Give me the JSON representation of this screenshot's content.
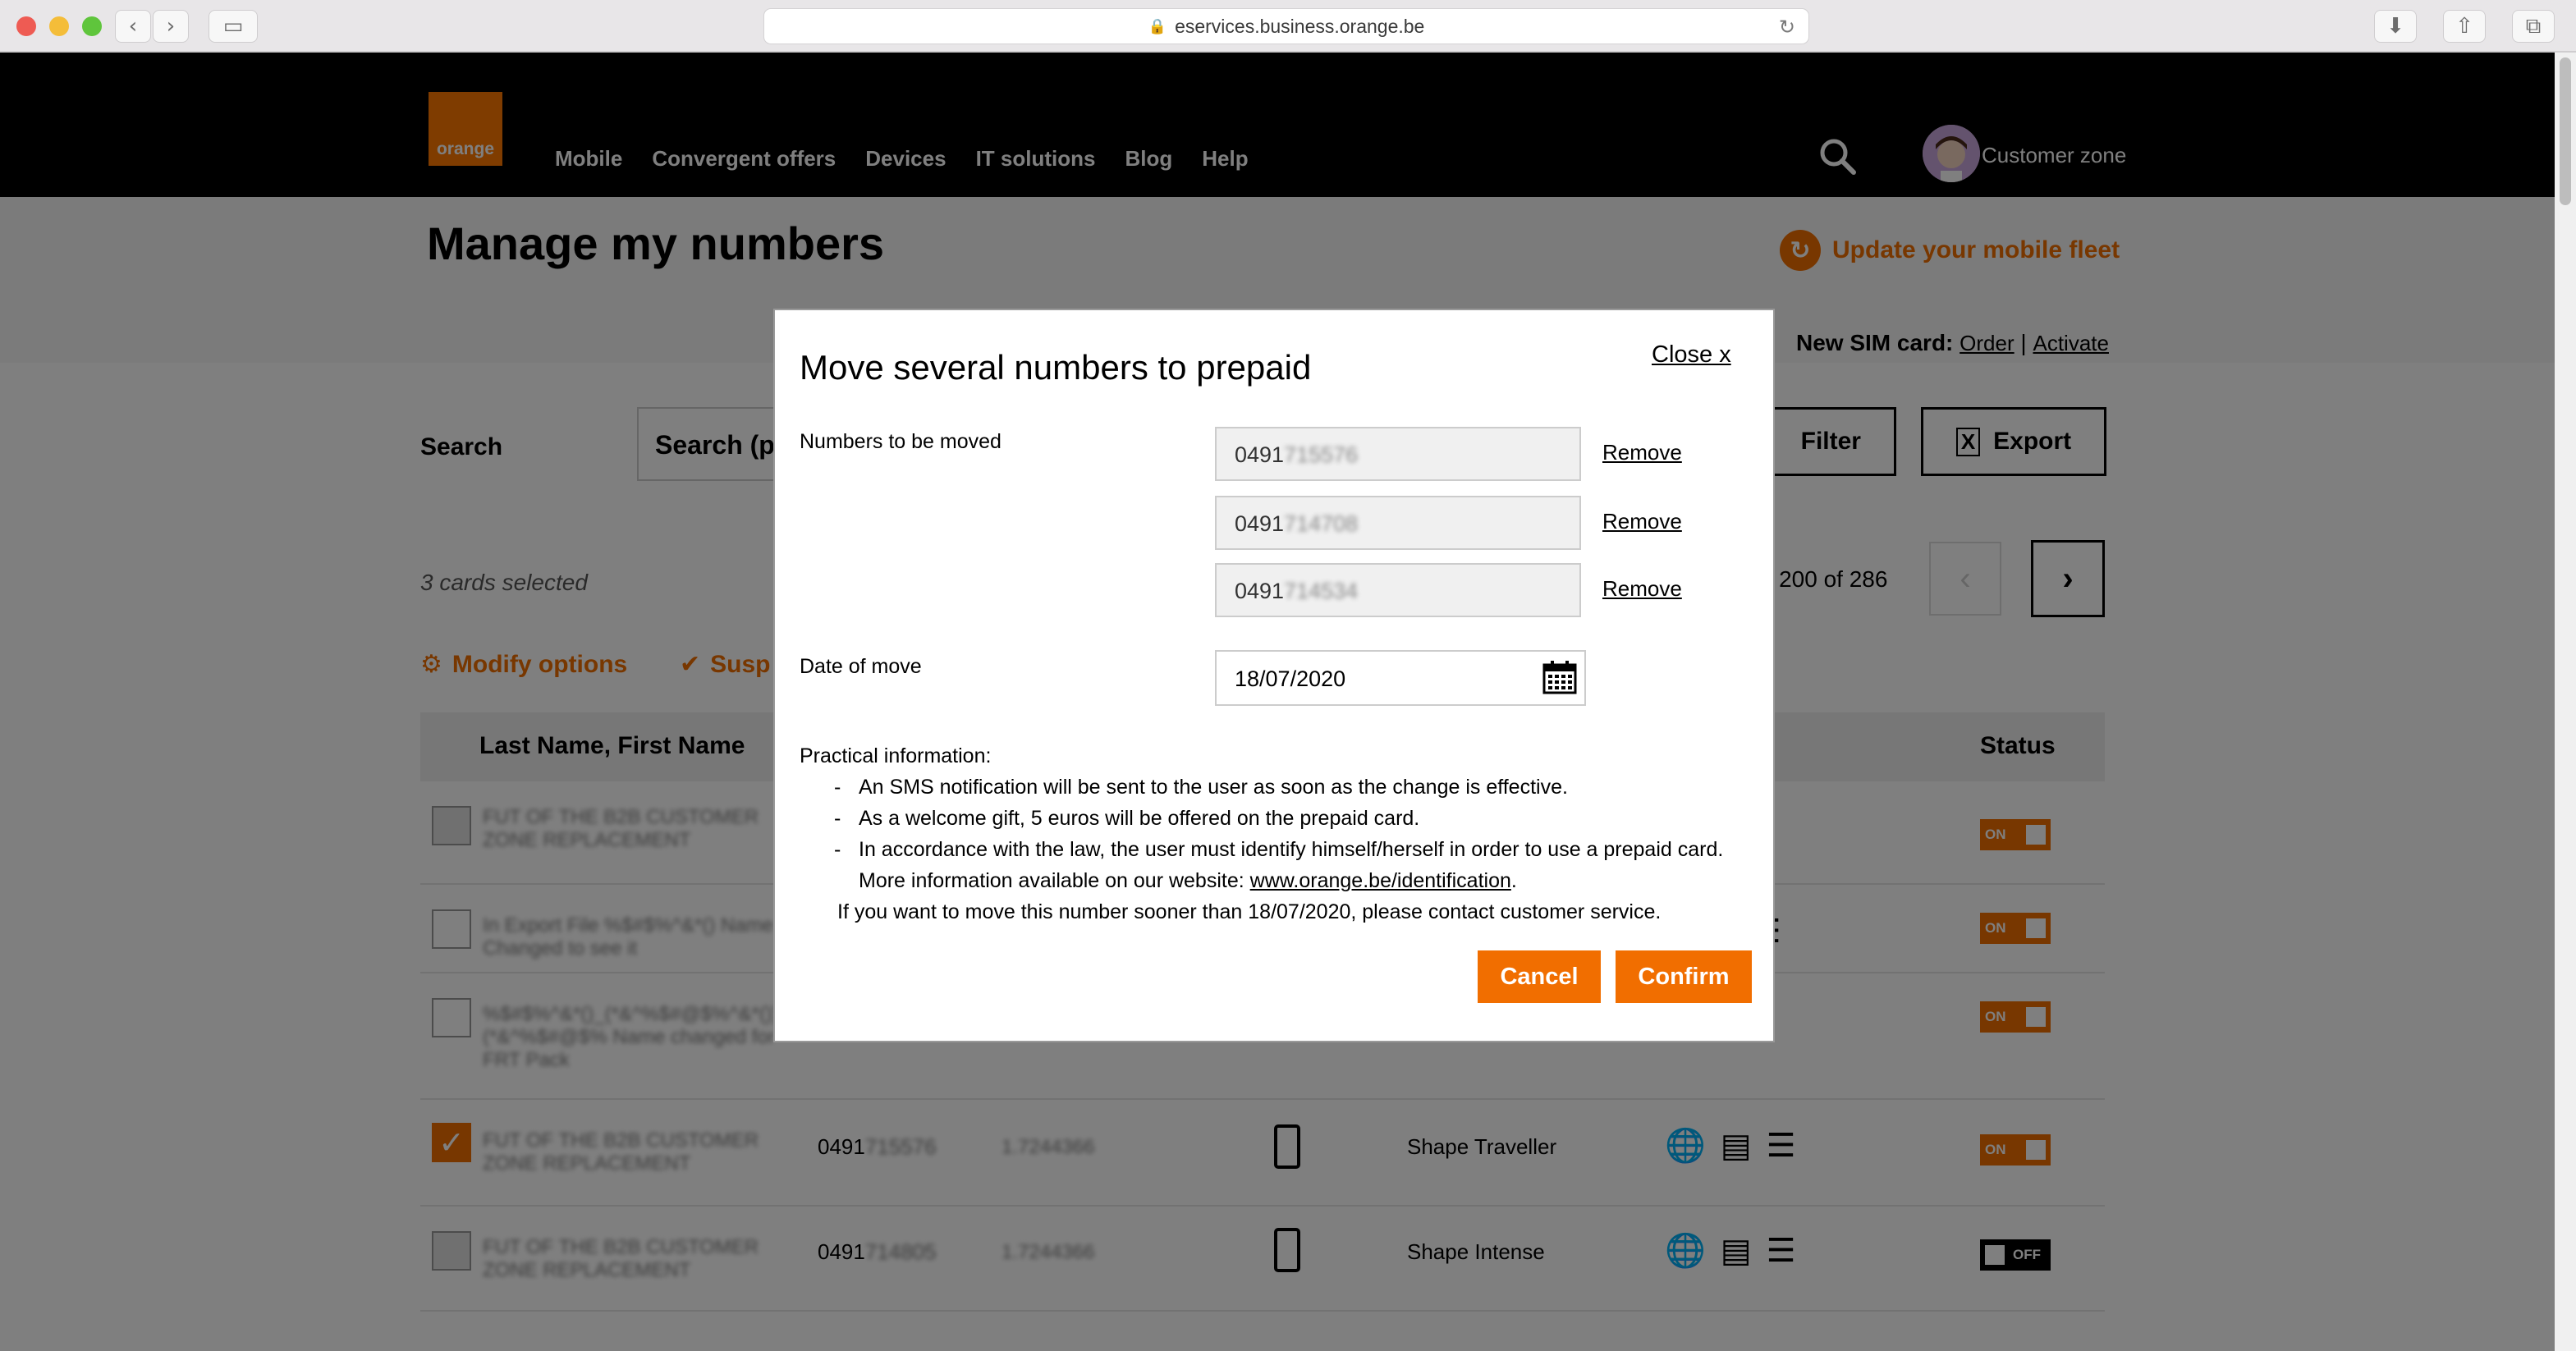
{
  "browser": {
    "url": "eservices.business.orange.be"
  },
  "header": {
    "logo_text": "orange",
    "nav": [
      "Mobile",
      "Convergent offers",
      "Devices",
      "IT solutions",
      "Blog",
      "Help"
    ],
    "customer_zone": "Customer zone"
  },
  "page": {
    "title": "Manage my numbers",
    "update_fleet": "Update your mobile fleet",
    "new_sim_label": "New SIM card:",
    "new_sim_order": "Order",
    "new_sim_sep": "|",
    "new_sim_activate": "Activate",
    "search_label": "Search",
    "search_placeholder": "Search (p",
    "filter_label": "Filter",
    "export_label": "Export",
    "cards_selected": "3 cards selected",
    "pager_text": "- 200 of 286",
    "modify_options": "Modify options",
    "suspend": "Susp",
    "table": {
      "col_name": "Last Name, First Name",
      "col_status": "Status",
      "rows": [
        {
          "name": "FUT OF THE B2B CUSTOMER ZONE REPLACEMENT",
          "number_prefix": "",
          "number_masked": "",
          "extra": "",
          "offer": "",
          "status": "ON"
        },
        {
          "name": "In Export File %$#$%^&*() Name Changed to see it",
          "number_prefix": "",
          "number_masked": "",
          "extra": "",
          "offer": "",
          "status": "ON"
        },
        {
          "name": "%$#$%^&*()_(*&^%$#@$%^&*()) (*&^%$#@$% Name changed for FRT Pack",
          "number_prefix": "",
          "number_masked": "",
          "extra": "",
          "offer": "",
          "status": "ON"
        },
        {
          "name": "FUT OF THE B2B CUSTOMER ZONE REPLACEMENT",
          "number_prefix": "0491",
          "number_masked": "715576",
          "extra": "1.7244366",
          "offer": "Shape Traveller",
          "status": "ON"
        },
        {
          "name": "FUT OF THE B2B CUSTOMER ZONE REPLACEMENT",
          "number_prefix": "0491",
          "number_masked": "714805",
          "extra": "1.7244366",
          "offer": "Shape Intense",
          "status": "OFF"
        }
      ]
    }
  },
  "modal": {
    "title": "Move several numbers to prepaid",
    "close": "Close x",
    "numbers_label": "Numbers to be moved",
    "numbers": [
      {
        "prefix": "0491",
        "masked": "715576"
      },
      {
        "prefix": "0491",
        "masked": "714708"
      },
      {
        "prefix": "0491",
        "masked": "714534"
      }
    ],
    "remove_label": "Remove",
    "date_label": "Date of move",
    "date_value": "18/07/2020",
    "practical_title": "Practical information:",
    "practical_items": [
      "An SMS notification will be sent to the user as soon as the change is effective.",
      "As a welcome gift, 5 euros will be offered on the prepaid card.",
      "In accordance with the law, the user must identify himself/herself in order to use a prepaid card."
    ],
    "more_info_prefix": "More information available on our website: ",
    "more_info_link": "www.orange.be/identification",
    "more_info_suffix": ".",
    "sooner_note": "If you want to move this number sooner than 18/07/2020, please contact customer service.",
    "cancel": "Cancel",
    "confirm": "Confirm"
  },
  "colors": {
    "brand_orange": "#f16e00",
    "logo_orange": "#ff7900"
  }
}
